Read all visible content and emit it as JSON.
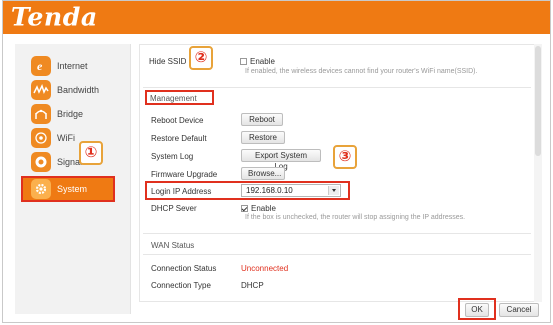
{
  "brand": {
    "logo_text": "Tenda",
    "accent": "#ef7a13",
    "highlight": "#e0301e"
  },
  "sidebar": {
    "items": [
      {
        "label": "Internet",
        "icon": "internet-explorer-icon"
      },
      {
        "label": "Bandwidth",
        "icon": "bandwidth-icon"
      },
      {
        "label": "Bridge",
        "icon": "bridge-icon"
      },
      {
        "label": "WiFi",
        "icon": "wifi-icon"
      },
      {
        "label": "Signal",
        "icon": "signal-icon"
      },
      {
        "label": "System",
        "icon": "gear-icon",
        "active": true
      }
    ]
  },
  "wireless": {
    "hide_ssid_label": "Hide SSID",
    "enable_label": "Enable",
    "hint": "If enabled, the wireless devices cannot find your router's WiFi name(SSID)."
  },
  "management": {
    "title": "Management",
    "reboot_label": "Reboot Device",
    "reboot_button": "Reboot",
    "restore_label": "Restore Default",
    "restore_button": "Restore",
    "log_label": "System Log",
    "log_button": "Export System Log",
    "firmware_label": "Firmware Upgrade",
    "firmware_button": "Browse...",
    "login_ip_label": "Login IP Address",
    "login_ip_value": "192.168.0.10",
    "dhcp_label": "DHCP Sever",
    "dhcp_enable": "Enable",
    "dhcp_hint": "If the box is unchecked, the router will stop assigning the IP addresses."
  },
  "wan": {
    "title": "WAN Status",
    "connection_status_label": "Connection Status",
    "connection_status_value": "Unconnected",
    "connection_type_label": "Connection Type",
    "connection_type_value": "DHCP"
  },
  "annotations": {
    "one": "①",
    "two": "②",
    "three": "③"
  },
  "footer": {
    "ok": "OK",
    "cancel": "Cancel"
  }
}
